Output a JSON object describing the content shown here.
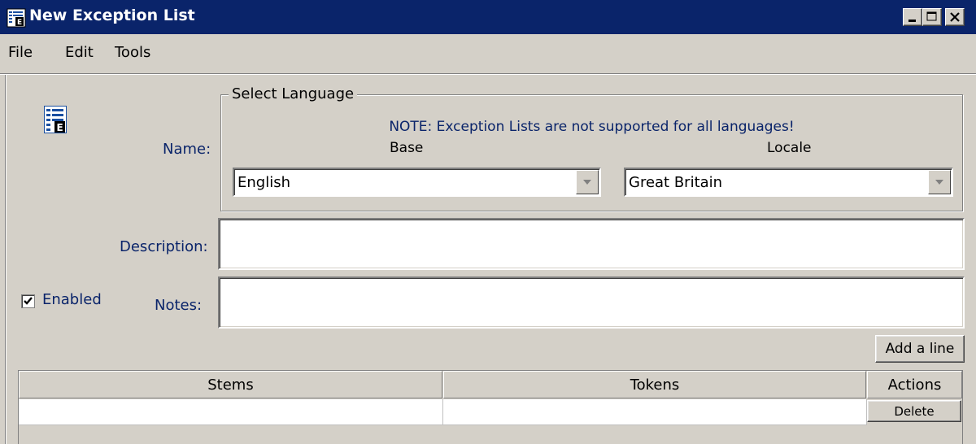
{
  "window": {
    "title": "New Exception List",
    "icon": "exception-list-icon",
    "controls": [
      "minimize-icon",
      "maximize-icon",
      "close-icon"
    ]
  },
  "menu": {
    "items": [
      "File",
      "Edit",
      "Tools"
    ]
  },
  "form": {
    "icon": "exception-list-icon",
    "name_label": "Name:",
    "description_label": "Description:",
    "notes_label": "Notes:",
    "description_value": "",
    "notes_value": "",
    "enabled_label": "Enabled",
    "enabled_checked": true,
    "language_group": {
      "title": "Select Language",
      "note": "NOTE: Exception Lists are not supported for all languages!",
      "base_label": "Base",
      "locale_label": "Locale",
      "base_value": "English",
      "locale_value": "Great Britain"
    },
    "add_line_button": "Add a line"
  },
  "table": {
    "columns": [
      "Stems",
      "Tokens",
      "Actions"
    ],
    "rows": [
      {
        "stems": "",
        "tokens": "",
        "action": "Delete"
      }
    ]
  },
  "colors": {
    "title_bar": "#0a246a",
    "label_text": "#0a246a",
    "face": "#d4d0c8"
  }
}
